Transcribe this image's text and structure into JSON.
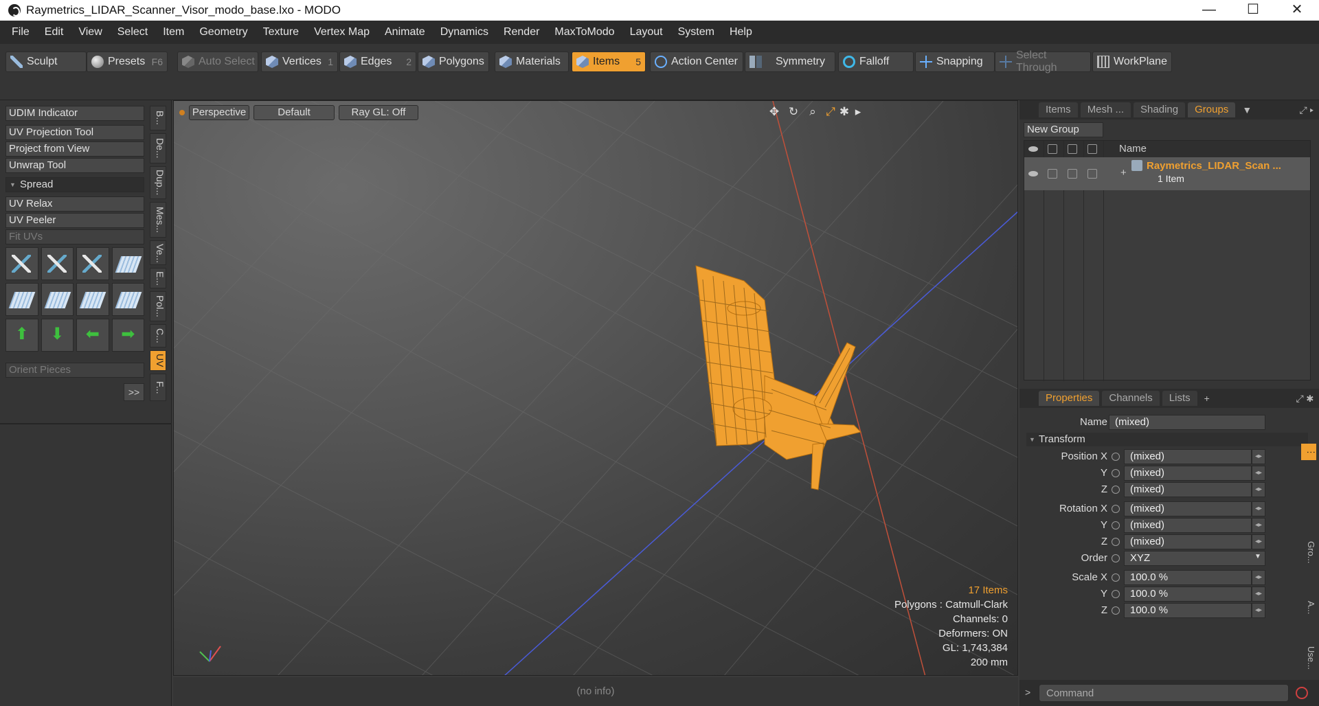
{
  "window": {
    "title": "Raymetrics_LIDAR_Scanner_Visor_modo_base.lxo - MODO",
    "controls": [
      "—",
      "☐",
      "✕"
    ]
  },
  "menubar": [
    "File",
    "Edit",
    "View",
    "Select",
    "Item",
    "Geometry",
    "Texture",
    "Vertex Map",
    "Animate",
    "Dynamics",
    "Render",
    "MaxToModo",
    "Layout",
    "System",
    "Help"
  ],
  "toolbar": {
    "sculpt": "Sculpt",
    "presets": "Presets",
    "presets_key": "F6",
    "auto_select": "Auto Select",
    "vertices": "Vertices",
    "vertices_num": "1",
    "edges": "Edges",
    "edges_num": "2",
    "polygons": "Polygons",
    "materials": "Materials",
    "items": "Items",
    "items_num": "5",
    "action_center": "Action Center",
    "symmetry": "Symmetry",
    "falloff": "Falloff",
    "snapping": "Snapping",
    "select_through": "Select Through",
    "workplane": "WorkPlane",
    "active_accent": "#f0a030"
  },
  "left_panel": {
    "udim": "UDIM Indicator",
    "uv_projection": "UV Projection Tool",
    "project_from_view": "Project from View",
    "unwrap": "Unwrap Tool",
    "spread": "Spread",
    "uv_relax": "UV Relax",
    "uv_peeler": "UV Peeler",
    "fit_uvs": "Fit UVs",
    "orient_pieces": "Orient Pieces",
    "expand": ">>",
    "vtabs": [
      "B...",
      "De...",
      "Dup...",
      "Mes...",
      "Ve...",
      "E...",
      "Pol...",
      "C...",
      "UV",
      "F..."
    ],
    "arrows": [
      "⬆",
      "⬇",
      "⬅",
      "➡"
    ]
  },
  "viewport": {
    "view": "Perspective",
    "shading": "Default",
    "raygl": "Ray GL: Off",
    "tools": [
      "✥",
      "↻",
      "⌕",
      "⤢",
      "✱",
      "▸"
    ],
    "info": {
      "items": "17 Items",
      "polygons": "Polygons : Catmull-Clark",
      "channels": "Channels: 0",
      "deformers": "Deformers: ON",
      "gl": "GL: 1,743,384",
      "unit": "200 mm"
    },
    "model_color": "#f0a030"
  },
  "status": "(no info)",
  "groups_panel": {
    "tabs": [
      "Items",
      "Mesh ...",
      "Shading",
      "Groups"
    ],
    "active_tab": "Groups",
    "new_group": "New Group",
    "col_name": "Name",
    "group_name": "Raymetrics_LIDAR_Scan ...",
    "group_sub": "1 Item"
  },
  "properties": {
    "tabs": [
      "Properties",
      "Channels",
      "Lists",
      "+"
    ],
    "name_label": "Name",
    "name_value": "(mixed)",
    "transform": "Transform",
    "position_label": "Position X",
    "rotation_label": "Rotation X",
    "scale_label": "Scale X",
    "y_label": "Y",
    "z_label": "Z",
    "order_label": "Order",
    "order_value": "XYZ",
    "px": "(mixed)",
    "py": "(mixed)",
    "pz": "(mixed)",
    "rx": "(mixed)",
    "ry": "(mixed)",
    "rz": "(mixed)",
    "sx": "100.0 %",
    "sy": "100.0 %",
    "sz": "100.0 %",
    "expand": ">>",
    "vtabs": [
      "Gro...",
      "A...",
      "Use..."
    ]
  },
  "command": {
    "prompt": ">",
    "placeholder": "Command"
  }
}
